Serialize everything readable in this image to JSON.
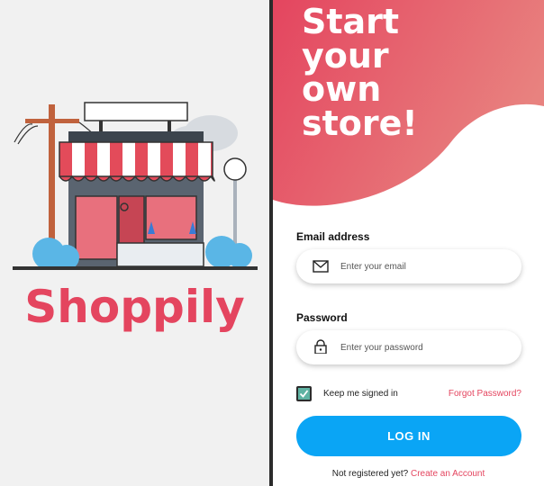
{
  "brand": {
    "name": "Shoppily"
  },
  "hero": {
    "title_lines": [
      "Start",
      "your",
      "own",
      "store!"
    ]
  },
  "form": {
    "email_label": "Email address",
    "email_placeholder": "Enter your email",
    "password_label": "Password",
    "password_placeholder": "Enter your password",
    "remember_label": "Keep me signed in",
    "remember_checked": true,
    "forgot_link": "Forgot Password?",
    "login_label": "LOG IN",
    "signup_prompt": "Not registered yet?",
    "signup_link": "Create an Account"
  },
  "icons": {
    "email": "envelope-icon",
    "password": "lock-icon",
    "checkbox": "checkmark-icon",
    "illustration": "storefront-illustration"
  },
  "colors": {
    "brand": "#e4455f",
    "hero_gradient_start": "#e4455f",
    "hero_gradient_end": "#e8827f",
    "button": "#0aa5f5",
    "checkbox": "#5fb3a3",
    "left_bg": "#f1f1f1"
  }
}
